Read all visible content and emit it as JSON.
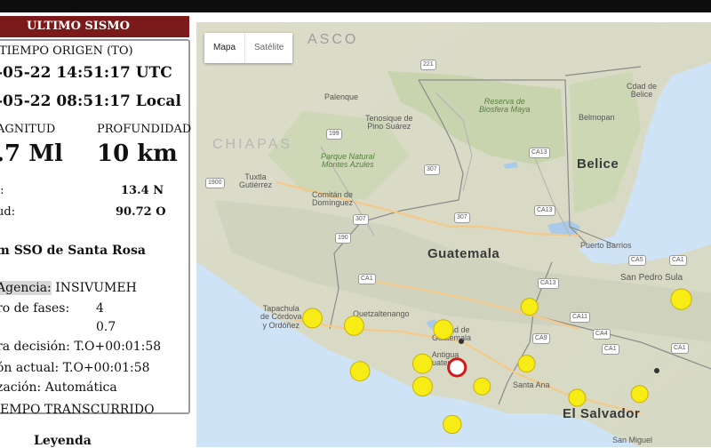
{
  "panel": {
    "header": "ULTIMO SISMO",
    "tiempo_origen_label": "TIEMPO ORIGEN (TO)",
    "utc": "-05-22 14:51:17 UTC",
    "local": "-05-22 08:51:17 Local",
    "magnitud_label": "AGNITUD",
    "profundidad_label": "PROFUNDIDAD",
    "magnitud_value": ".7 Ml",
    "profundidad_value": "10 km",
    "lat_label": "l:",
    "lat_value": "13.4 N",
    "lon_label": "ud:",
    "lon_value": "90.72 O",
    "location": "m SSO de Santa Rosa",
    "agencia_label": "Agencia:",
    "agencia_value": "INSIVUMEH",
    "fases_label": "ro de fases:",
    "fases_value": "4",
    "rms_value": "0.7",
    "decision": "ra decisión: T.O+00:01:58",
    "actual": "ón actual: T.O+00:01:58",
    "ubicacion": "zación: Automática",
    "transcurrido": "EMPO TRANSCURRIDO",
    "leyenda": "Leyenda"
  },
  "map": {
    "btn_map": "Mapa",
    "btn_sat": "Satélite",
    "labels": {
      "mexico": "ASCO",
      "chiapas": "CHIAPAS",
      "guatemala": "Guatemala",
      "belice": "Belice",
      "elsalvador": "El Salvador",
      "palenque": "Palenque",
      "tenosique": "Tenosique de\nPino Suárez",
      "reserva": "Reserva de\nBiosfera Maya",
      "cdad": "Cdad de\nBelice",
      "belmopan": "Belmopan",
      "parque": "Parque Natural\nMontes Azules",
      "tuxtla": "Tuxtla\nGutiérrez",
      "comitan": "Comitán de\nDomínguez",
      "puerto": "Puerto Barrios",
      "sanpedro": "San Pedro Sula",
      "tapachula": "Tapachula\nde Córdova\ny Ordóñez",
      "quetzal": "Quetzaltenango",
      "guatecity": "Ciudad de\nGuatemala",
      "antigua": "Antigua\nGuatemala",
      "santaana": "Santa Ana",
      "sanmiguel": "San Miguel"
    },
    "shields": [
      "221",
      "199",
      "307",
      "CA13",
      "1900",
      "307",
      "307",
      "190",
      "CA13",
      "CA1",
      "CA13",
      "CA9",
      "CA5",
      "CA1",
      "CA4",
      "CA11",
      "CA1",
      "CA1"
    ]
  },
  "quakes": [
    {
      "lon": -93.15,
      "lat": 14.05,
      "mag": 3.2
    },
    {
      "lon": -92.45,
      "lat": 13.95,
      "mag": 3.2
    },
    {
      "lon": -92.35,
      "lat": 13.35,
      "mag": 3.2
    },
    {
      "lon": -91.3,
      "lat": 13.45,
      "mag": 3.2
    },
    {
      "lon": -91.3,
      "lat": 13.15,
      "mag": 3.2
    },
    {
      "lon": -90.95,
      "lat": 13.9,
      "mag": 3.2
    },
    {
      "lon": -90.3,
      "lat": 13.15,
      "mag": 2.8
    },
    {
      "lon": -89.55,
      "lat": 13.45,
      "mag": 2.8
    },
    {
      "lon": -89.5,
      "lat": 14.2,
      "mag": 2.8
    },
    {
      "lon": -88.7,
      "lat": 13.0,
      "mag": 2.8
    },
    {
      "lon": -87.65,
      "lat": 13.05,
      "mag": 2.8
    },
    {
      "lon": -86.95,
      "lat": 14.3,
      "mag": 3.4
    },
    {
      "lon": -90.8,
      "lat": 12.65,
      "mag": 3.0
    }
  ],
  "latest": {
    "lon": -90.72,
    "lat": 13.4,
    "mag": 3.7
  },
  "colors": {
    "header": "#7a1a1a",
    "quake_fill": "#f8ec16",
    "quake_stroke": "#c8b200",
    "latest_ring": "#d21a1a"
  }
}
